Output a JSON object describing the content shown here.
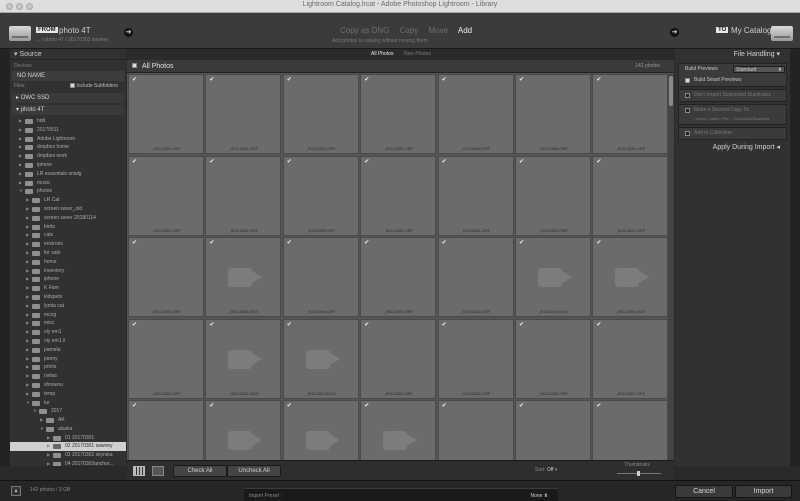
{
  "window": {
    "title": "Lightroom Catalog.lrcat - Adobe Photoshop Lightroom - Library"
  },
  "header": {
    "from_badge": "FROM",
    "from_name": "photo 4T",
    "from_sub": "... / photo 4T / 20170301 sawney",
    "modes": [
      "Copy as DNG",
      "Copy",
      "Move",
      "Add"
    ],
    "active_mode": "Add",
    "modes_sub": "Add photos to catalog without moving them",
    "to_badge": "TO",
    "to_name": "My Catalog"
  },
  "source": {
    "title": "Source",
    "devices_label": "Devices",
    "device": "NO NAME",
    "files_label": "Files",
    "include_subfolders": "Include Subfolders",
    "volume_1": "OWC SSD",
    "volume_2": "photo 4T",
    "tree": [
      {
        "d": 1,
        "n": "hdd"
      },
      {
        "d": 1,
        "n": "20170511"
      },
      {
        "d": 1,
        "n": "Adobe Lightroom"
      },
      {
        "d": 1,
        "n": "dropbox home"
      },
      {
        "d": 1,
        "n": "dropbox work"
      },
      {
        "d": 1,
        "n": "iphone"
      },
      {
        "d": 1,
        "n": "LR essentials onwlg"
      },
      {
        "d": 1,
        "n": "music"
      },
      {
        "d": 1,
        "n": "photos",
        "open": true
      },
      {
        "d": 2,
        "n": "LR Cat"
      },
      {
        "d": 2,
        "n": "screen saver_old"
      },
      {
        "d": 2,
        "n": "screen saver 20180114"
      },
      {
        "d": 2,
        "n": "birds"
      },
      {
        "d": 2,
        "n": "cats"
      },
      {
        "d": 2,
        "n": "environs"
      },
      {
        "d": 2,
        "n": "for sale"
      },
      {
        "d": 2,
        "n": "home"
      },
      {
        "d": 2,
        "n": "inventory"
      },
      {
        "d": 2,
        "n": "iphone"
      },
      {
        "d": 2,
        "n": "K Fam"
      },
      {
        "d": 2,
        "n": "kidspets"
      },
      {
        "d": 2,
        "n": "lynda cat"
      },
      {
        "d": 2,
        "n": "mcng"
      },
      {
        "d": 2,
        "n": "misc"
      },
      {
        "d": 2,
        "n": "oly em1"
      },
      {
        "d": 2,
        "n": "oly em1 ii"
      },
      {
        "d": 2,
        "n": "pamela"
      },
      {
        "d": 2,
        "n": "penny"
      },
      {
        "d": 2,
        "n": "prints"
      },
      {
        "d": 2,
        "n": "rivitas"
      },
      {
        "d": 2,
        "n": "shosenu"
      },
      {
        "d": 2,
        "n": "temp"
      },
      {
        "d": 2,
        "n": "tur",
        "open": true
      },
      {
        "d": 3,
        "n": "2017",
        "open": true
      },
      {
        "d": 4,
        "n": "AK"
      },
      {
        "d": 4,
        "n": "alaska",
        "open": true
      },
      {
        "d": 5,
        "n": "01 20170301"
      },
      {
        "d": 5,
        "n": "02 20170301 sawney",
        "sel": true
      },
      {
        "d": 5,
        "n": "03 20170302 skyrska"
      },
      {
        "d": 5,
        "n": "04 20170303anchor..."
      }
    ]
  },
  "center": {
    "tabs": [
      "All Photos",
      "New Photos"
    ],
    "grid_title": "All Photos",
    "count": "142 photos",
    "rows": [
      [
        "_IKD12830.ORF",
        "_IKD12831.ORF",
        "_IKD12832.ORF",
        "_IKD12833.ORF",
        "_IKD12834.ORF",
        "_IKD12835.ORF",
        "_IKD12836.ORF"
      ],
      [
        "_IKD12837.ORF",
        "_IKD12838.ORF",
        "_IKD12839.ORF",
        "_IKD12840.ORF",
        "_IKD12841.ORF",
        "_IKD12842.ORF",
        "_IKD12843.ORF"
      ],
      [
        "_IKD12844.ORF",
        "_IKD12845.MOV",
        "_IKD12846.ORF",
        "_IKD12847.ORF",
        "_IKD12848.ORF",
        "_IKD12849.MOV",
        "_IKD12850.MOV"
      ],
      [
        "_IKD12851.ORF",
        "_IKD12852.MOV",
        "_IKD12853.MOV",
        "_IKD12854.ORF",
        "_IKD12855.ORF",
        "_IKD12856.ORF",
        "_IKD12857.ORF"
      ],
      [
        "",
        "",
        "",
        "",
        "",
        "",
        ""
      ]
    ],
    "video_cells": [
      [
        2,
        1
      ],
      [
        2,
        5
      ],
      [
        2,
        6
      ],
      [
        3,
        1
      ],
      [
        3,
        2
      ],
      [
        4,
        1
      ],
      [
        4,
        2
      ],
      [
        4,
        3
      ]
    ],
    "check_all": "Check All",
    "uncheck_all": "Uncheck All",
    "sort_label": "Sort:",
    "sort_value": "Off",
    "thumbnails_label": "Thumbnails"
  },
  "file_handling": {
    "title": "File Handling",
    "build_previews_label": "Build Previews",
    "build_previews_value": "Standard",
    "build_smart_previews": "Build Smart Previews",
    "dont_import_duplicates": "Don't Import Suspected Duplicates",
    "second_copy": "Make a Second Copy To:",
    "second_copy_path": "/ Users / jallen / Pic... / Download Backups",
    "add_to_collection": "Add to Collection",
    "apply_during_import": "Apply During Import"
  },
  "footer": {
    "info": "142 photos / 3 GB",
    "preset_label": "Import Preset :",
    "preset_value": "None",
    "cancel": "Cancel",
    "import": "Import"
  }
}
